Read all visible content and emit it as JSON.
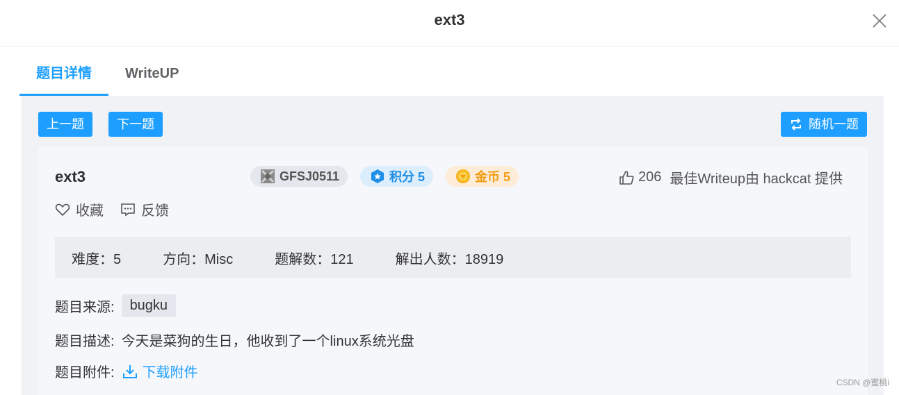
{
  "header": {
    "title": "ext3"
  },
  "tabs": [
    {
      "label": "题目详情"
    },
    {
      "label": "WriteUP"
    }
  ],
  "toolbar": {
    "prev_label": "上一题",
    "next_label": "下一题",
    "random_label": "随机一题"
  },
  "challenge": {
    "title": "ext3",
    "id_badge": "GFSJ0511",
    "score_label": "积分 5",
    "gold_label": "金币 5",
    "likes": "206",
    "writeup_note": "最佳Writeup由 hackcat 提供",
    "favorite_label": "收藏",
    "feedback_label": "反馈"
  },
  "stats": {
    "difficulty": "难度：5",
    "direction": "方向：Misc",
    "solves": "题解数：121",
    "solvers": "解出人数：18919"
  },
  "details": {
    "source_label": "题目来源:",
    "source_value": "bugku",
    "desc_label": "题目描述:",
    "desc_value": "今天是菜狗的生日，他收到了一个linux系统光盘",
    "attach_label": "题目附件:",
    "download_label": "下载附件"
  },
  "watermark": "CSDN @蜜桃i",
  "colors": {
    "accent": "#1e9fff",
    "gold": "#f39b12"
  }
}
